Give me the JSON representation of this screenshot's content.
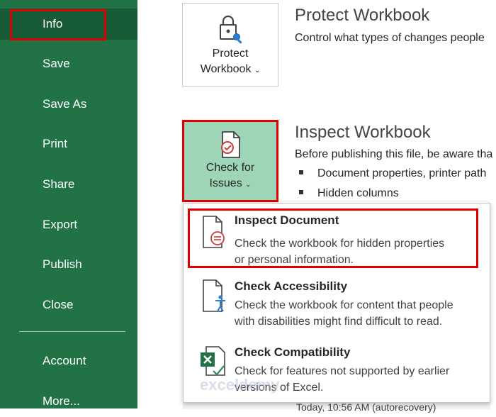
{
  "sidebar": {
    "items": [
      {
        "label": "Info"
      },
      {
        "label": "Save"
      },
      {
        "label": "Save As"
      },
      {
        "label": "Print"
      },
      {
        "label": "Share"
      },
      {
        "label": "Export"
      },
      {
        "label": "Publish"
      },
      {
        "label": "Close"
      },
      {
        "label": "Account"
      },
      {
        "label": "More..."
      }
    ]
  },
  "protect": {
    "button_line1": "Protect",
    "button_line2": "Workbook",
    "title": "Protect Workbook",
    "desc": "Control what types of changes people"
  },
  "inspect": {
    "button_line1": "Check for",
    "button_line2": "Issues",
    "title": "Inspect Workbook",
    "desc": "Before publishing this file, be aware tha",
    "bullets": [
      "Document properties, printer path",
      "Hidden columns"
    ]
  },
  "menu": {
    "items": [
      {
        "title": "Inspect Document",
        "desc1": "Check the workbook for hidden properties",
        "desc2": "or personal information."
      },
      {
        "title": "Check Accessibility",
        "desc1": "Check the workbook for content that people",
        "desc2": "with disabilities might find difficult to read."
      },
      {
        "title": "Check Compatibility",
        "desc1": "Check for features not supported by earlier",
        "desc2": "versions of Excel."
      }
    ]
  },
  "autorecover": "Today, 10:56 AM (autorecovery)",
  "watermark": "exceldemy",
  "colors": {
    "sidebar": "#217346",
    "sidebar_active": "#185c37",
    "highlight": "#e00000",
    "selected_button": "#9fd5b7"
  }
}
